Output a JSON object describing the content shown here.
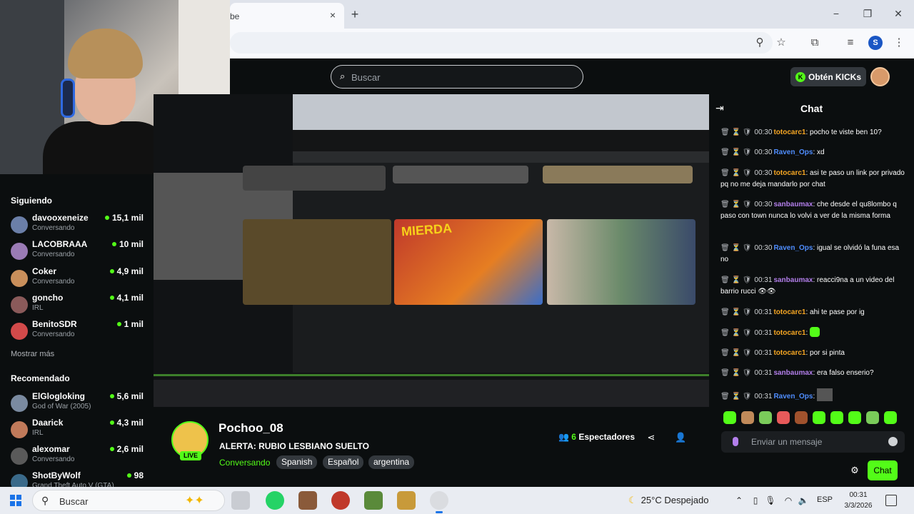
{
  "browser": {
    "tab_title": "be",
    "tab_close": "×",
    "new_tab": "+",
    "profile_initial": "S",
    "window_controls": {
      "minimize": "−",
      "maximize": "❐",
      "close": "✕"
    }
  },
  "kick_header": {
    "search_placeholder": "Buscar",
    "get_kicks_label": "Obtén KICKs"
  },
  "sidebar": {
    "following_title": "Siguiendo",
    "following": [
      {
        "name": "davooxeneize",
        "category": "Conversando",
        "viewers": "15,1 mil",
        "avatar_color": "#6b7fa8"
      },
      {
        "name": "LACOBRAAA",
        "category": "Conversando",
        "viewers": "10 mil",
        "avatar_color": "#9a7bb5"
      },
      {
        "name": "Coker",
        "category": "Conversando",
        "viewers": "4,9 mil",
        "avatar_color": "#c98f5b"
      },
      {
        "name": "goncho",
        "category": "IRL",
        "viewers": "4,1 mil",
        "avatar_color": "#8a5a5a"
      },
      {
        "name": "BenitoSDR",
        "category": "Conversando",
        "viewers": "1 mil",
        "avatar_color": "#d24a4a"
      }
    ],
    "show_more": "Mostrar más",
    "recommended_title": "Recomendado",
    "recommended": [
      {
        "name": "ElGlogloking",
        "category": "God of War (2005)",
        "viewers": "5,6 mil",
        "avatar_color": "#7a8aa0"
      },
      {
        "name": "Daarick",
        "category": "IRL",
        "viewers": "4,3 mil",
        "avatar_color": "#c07a5a"
      },
      {
        "name": "alexomar",
        "category": "Conversando",
        "viewers": "2,6 mil",
        "avatar_color": "#5a5a5a"
      },
      {
        "name": "ShotByWolf",
        "category": "Grand Theft Auto V (GTA)",
        "viewers": "98",
        "avatar_color": "#3a6a8a"
      }
    ]
  },
  "video": {
    "thumb_text": "MIERDA"
  },
  "stream": {
    "channel_name": "Pochoo_08",
    "live_badge": "LIVE",
    "title": "ALERTA: RUBIO LESBIANO SUELTO",
    "category": "Conversando",
    "tags": [
      "Spanish",
      "Español",
      "argentina"
    ],
    "viewers_count": "6",
    "viewers_label": "Espectadores"
  },
  "chat": {
    "title": "Chat",
    "messages": [
      {
        "time": "00:30",
        "user": "totocarc1",
        "color": "orange",
        "text": ": pocho te viste ben 10?"
      },
      {
        "time": "00:30",
        "user": "Raven_Ops",
        "color": "blue",
        "text": ": xd"
      },
      {
        "time": "00:30",
        "user": "totocarc1",
        "color": "orange",
        "text": ": asi te paso un link por privado pq no me deja mandarlo por chat"
      },
      {
        "time": "00:30",
        "user": "sanbaumax",
        "color": "purple",
        "text": ": che desde el qu8lombo q paso con town nunca lo volvi a ver de la misma forma"
      },
      {
        "time": "00:30",
        "user": "Raven_Ops",
        "color": "blue",
        "text": ": igual se olvidó la funa esa no"
      },
      {
        "time": "00:31",
        "user": "sanbaumax",
        "color": "purple",
        "text": ": reacci9na a un video del barrio rucci 👁👁"
      },
      {
        "time": "00:31",
        "user": "totocarc1",
        "color": "orange",
        "text": ": ahi te pase por ig"
      },
      {
        "time": "00:31",
        "user": "totocarc1",
        "color": "orange",
        "text": ":"
      },
      {
        "time": "00:31",
        "user": "totocarc1",
        "color": "orange",
        "text": ": por si pinta"
      },
      {
        "time": "00:31",
        "user": "sanbaumax",
        "color": "purple",
        "text": ": era falso enserio?"
      },
      {
        "time": "00:31",
        "user": "Raven_Ops",
        "color": "blue",
        "text": ":"
      }
    ],
    "input_placeholder": "Enviar un mensaje",
    "send_label": "Chat"
  },
  "taskbar": {
    "search_placeholder": "Buscar",
    "weather_temp": "25°C",
    "weather_desc": "Despejado",
    "language": "ESP",
    "time": "00:31",
    "date": "3/3/2026"
  }
}
